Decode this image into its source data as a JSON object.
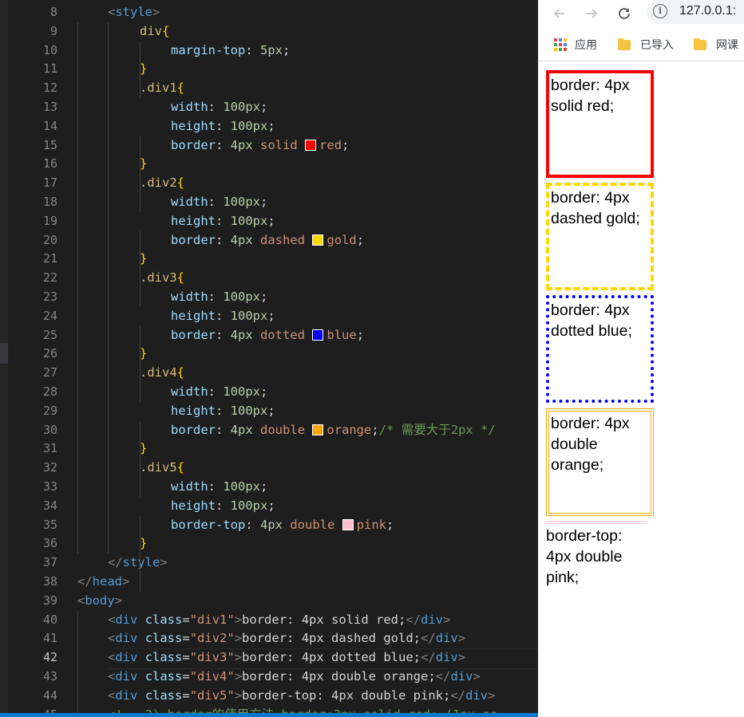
{
  "editor": {
    "line_numbers": [
      "8",
      "9",
      "10",
      "11",
      "12",
      "13",
      "14",
      "15",
      "16",
      "17",
      "18",
      "19",
      "20",
      "21",
      "22",
      "23",
      "24",
      "25",
      "26",
      "27",
      "28",
      "29",
      "30",
      "31",
      "32",
      "33",
      "34",
      "35",
      "36",
      "37",
      "38",
      "39",
      "40",
      "41",
      "42",
      "43",
      "44",
      "45"
    ],
    "active_line": "42",
    "style_open": "<style>",
    "style_close": "</style>",
    "head_close": "</head>",
    "body_open": "<body>",
    "rules": [
      {
        "selector": "div",
        "decls": [
          {
            "prop": "margin-top",
            "num": "5px",
            "val": ""
          }
        ]
      },
      {
        "selector": ".div1",
        "decls": [
          {
            "prop": "width",
            "num": "100px",
            "val": ""
          },
          {
            "prop": "height",
            "num": "100px",
            "val": ""
          },
          {
            "prop": "border",
            "num": "4px",
            "val": "solid",
            "color_name": "red",
            "color": "#ff0000"
          }
        ]
      },
      {
        "selector": ".div2",
        "decls": [
          {
            "prop": "width",
            "num": "100px",
            "val": ""
          },
          {
            "prop": "height",
            "num": "100px",
            "val": ""
          },
          {
            "prop": "border",
            "num": "4px",
            "val": "dashed",
            "color_name": "gold",
            "color": "#ffd700"
          }
        ]
      },
      {
        "selector": ".div3",
        "decls": [
          {
            "prop": "width",
            "num": "100px",
            "val": ""
          },
          {
            "prop": "height",
            "num": "100px",
            "val": ""
          },
          {
            "prop": "border",
            "num": "4px",
            "val": "dotted",
            "color_name": "blue",
            "color": "#0000ff"
          }
        ]
      },
      {
        "selector": ".div4",
        "decls": [
          {
            "prop": "width",
            "num": "100px",
            "val": ""
          },
          {
            "prop": "height",
            "num": "100px",
            "val": ""
          },
          {
            "prop": "border",
            "num": "4px",
            "val": "double",
            "color_name": "orange",
            "color": "#ffa500",
            "comment": "/* 需要大于2px */"
          }
        ]
      },
      {
        "selector": ".div5",
        "decls": [
          {
            "prop": "width",
            "num": "100px",
            "val": ""
          },
          {
            "prop": "height",
            "num": "100px",
            "val": ""
          },
          {
            "prop": "border-top",
            "num": "4px",
            "val": "double",
            "color_name": "pink",
            "color": "#ffc0cb"
          }
        ]
      }
    ],
    "body_divs": [
      {
        "cls": "div1",
        "text": "border: 4px solid red;"
      },
      {
        "cls": "div2",
        "text": "border: 4px dashed gold;"
      },
      {
        "cls": "div3",
        "text": "border: 4px dotted blue;"
      },
      {
        "cls": "div4",
        "text": "border: 4px double orange;"
      },
      {
        "cls": "div5",
        "text": "border-top: 4px double pink;"
      }
    ],
    "cut_line": "<!-- 2) border的使用方法 border:3px solid red; (1px so"
  },
  "browser": {
    "url": "127.0.0.1:",
    "bookmarks": [
      {
        "label": "应用",
        "icon": "apps-grid-icon"
      },
      {
        "label": "已导入",
        "icon": "folder-icon"
      },
      {
        "label": "网课",
        "icon": "folder-icon"
      }
    ],
    "demos": [
      {
        "text": "border: 4px solid red;"
      },
      {
        "text": "border: 4px dashed gold;"
      },
      {
        "text": "border: 4px dotted blue;"
      },
      {
        "text": "border: 4px double orange;"
      },
      {
        "text": "border-top: 4px double pink;"
      }
    ]
  }
}
